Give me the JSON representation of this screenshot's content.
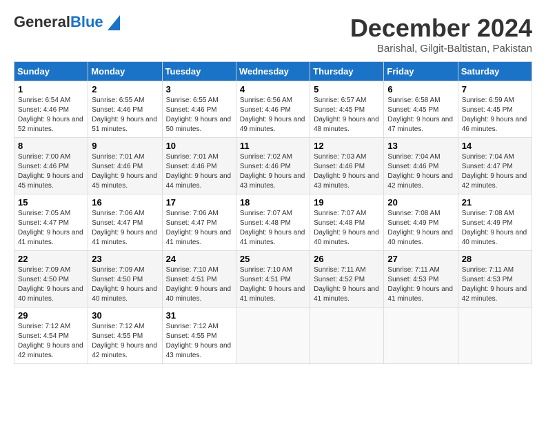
{
  "header": {
    "logo_line1": "General",
    "logo_line2": "Blue",
    "title": "December 2024",
    "subtitle": "Barishal, Gilgit-Baltistan, Pakistan"
  },
  "weekdays": [
    "Sunday",
    "Monday",
    "Tuesday",
    "Wednesday",
    "Thursday",
    "Friday",
    "Saturday"
  ],
  "weeks": [
    [
      {
        "day": "1",
        "sunrise": "Sunrise: 6:54 AM",
        "sunset": "Sunset: 4:46 PM",
        "daylight": "Daylight: 9 hours and 52 minutes."
      },
      {
        "day": "2",
        "sunrise": "Sunrise: 6:55 AM",
        "sunset": "Sunset: 4:46 PM",
        "daylight": "Daylight: 9 hours and 51 minutes."
      },
      {
        "day": "3",
        "sunrise": "Sunrise: 6:55 AM",
        "sunset": "Sunset: 4:46 PM",
        "daylight": "Daylight: 9 hours and 50 minutes."
      },
      {
        "day": "4",
        "sunrise": "Sunrise: 6:56 AM",
        "sunset": "Sunset: 4:46 PM",
        "daylight": "Daylight: 9 hours and 49 minutes."
      },
      {
        "day": "5",
        "sunrise": "Sunrise: 6:57 AM",
        "sunset": "Sunset: 4:45 PM",
        "daylight": "Daylight: 9 hours and 48 minutes."
      },
      {
        "day": "6",
        "sunrise": "Sunrise: 6:58 AM",
        "sunset": "Sunset: 4:45 PM",
        "daylight": "Daylight: 9 hours and 47 minutes."
      },
      {
        "day": "7",
        "sunrise": "Sunrise: 6:59 AM",
        "sunset": "Sunset: 4:45 PM",
        "daylight": "Daylight: 9 hours and 46 minutes."
      }
    ],
    [
      {
        "day": "8",
        "sunrise": "Sunrise: 7:00 AM",
        "sunset": "Sunset: 4:46 PM",
        "daylight": "Daylight: 9 hours and 45 minutes."
      },
      {
        "day": "9",
        "sunrise": "Sunrise: 7:01 AM",
        "sunset": "Sunset: 4:46 PM",
        "daylight": "Daylight: 9 hours and 45 minutes."
      },
      {
        "day": "10",
        "sunrise": "Sunrise: 7:01 AM",
        "sunset": "Sunset: 4:46 PM",
        "daylight": "Daylight: 9 hours and 44 minutes."
      },
      {
        "day": "11",
        "sunrise": "Sunrise: 7:02 AM",
        "sunset": "Sunset: 4:46 PM",
        "daylight": "Daylight: 9 hours and 43 minutes."
      },
      {
        "day": "12",
        "sunrise": "Sunrise: 7:03 AM",
        "sunset": "Sunset: 4:46 PM",
        "daylight": "Daylight: 9 hours and 43 minutes."
      },
      {
        "day": "13",
        "sunrise": "Sunrise: 7:04 AM",
        "sunset": "Sunset: 4:46 PM",
        "daylight": "Daylight: 9 hours and 42 minutes."
      },
      {
        "day": "14",
        "sunrise": "Sunrise: 7:04 AM",
        "sunset": "Sunset: 4:47 PM",
        "daylight": "Daylight: 9 hours and 42 minutes."
      }
    ],
    [
      {
        "day": "15",
        "sunrise": "Sunrise: 7:05 AM",
        "sunset": "Sunset: 4:47 PM",
        "daylight": "Daylight: 9 hours and 41 minutes."
      },
      {
        "day": "16",
        "sunrise": "Sunrise: 7:06 AM",
        "sunset": "Sunset: 4:47 PM",
        "daylight": "Daylight: 9 hours and 41 minutes."
      },
      {
        "day": "17",
        "sunrise": "Sunrise: 7:06 AM",
        "sunset": "Sunset: 4:47 PM",
        "daylight": "Daylight: 9 hours and 41 minutes."
      },
      {
        "day": "18",
        "sunrise": "Sunrise: 7:07 AM",
        "sunset": "Sunset: 4:48 PM",
        "daylight": "Daylight: 9 hours and 41 minutes."
      },
      {
        "day": "19",
        "sunrise": "Sunrise: 7:07 AM",
        "sunset": "Sunset: 4:48 PM",
        "daylight": "Daylight: 9 hours and 40 minutes."
      },
      {
        "day": "20",
        "sunrise": "Sunrise: 7:08 AM",
        "sunset": "Sunset: 4:49 PM",
        "daylight": "Daylight: 9 hours and 40 minutes."
      },
      {
        "day": "21",
        "sunrise": "Sunrise: 7:08 AM",
        "sunset": "Sunset: 4:49 PM",
        "daylight": "Daylight: 9 hours and 40 minutes."
      }
    ],
    [
      {
        "day": "22",
        "sunrise": "Sunrise: 7:09 AM",
        "sunset": "Sunset: 4:50 PM",
        "daylight": "Daylight: 9 hours and 40 minutes."
      },
      {
        "day": "23",
        "sunrise": "Sunrise: 7:09 AM",
        "sunset": "Sunset: 4:50 PM",
        "daylight": "Daylight: 9 hours and 40 minutes."
      },
      {
        "day": "24",
        "sunrise": "Sunrise: 7:10 AM",
        "sunset": "Sunset: 4:51 PM",
        "daylight": "Daylight: 9 hours and 40 minutes."
      },
      {
        "day": "25",
        "sunrise": "Sunrise: 7:10 AM",
        "sunset": "Sunset: 4:51 PM",
        "daylight": "Daylight: 9 hours and 41 minutes."
      },
      {
        "day": "26",
        "sunrise": "Sunrise: 7:11 AM",
        "sunset": "Sunset: 4:52 PM",
        "daylight": "Daylight: 9 hours and 41 minutes."
      },
      {
        "day": "27",
        "sunrise": "Sunrise: 7:11 AM",
        "sunset": "Sunset: 4:53 PM",
        "daylight": "Daylight: 9 hours and 41 minutes."
      },
      {
        "day": "28",
        "sunrise": "Sunrise: 7:11 AM",
        "sunset": "Sunset: 4:53 PM",
        "daylight": "Daylight: 9 hours and 42 minutes."
      }
    ],
    [
      {
        "day": "29",
        "sunrise": "Sunrise: 7:12 AM",
        "sunset": "Sunset: 4:54 PM",
        "daylight": "Daylight: 9 hours and 42 minutes."
      },
      {
        "day": "30",
        "sunrise": "Sunrise: 7:12 AM",
        "sunset": "Sunset: 4:55 PM",
        "daylight": "Daylight: 9 hours and 42 minutes."
      },
      {
        "day": "31",
        "sunrise": "Sunrise: 7:12 AM",
        "sunset": "Sunset: 4:55 PM",
        "daylight": "Daylight: 9 hours and 43 minutes."
      },
      null,
      null,
      null,
      null
    ]
  ]
}
